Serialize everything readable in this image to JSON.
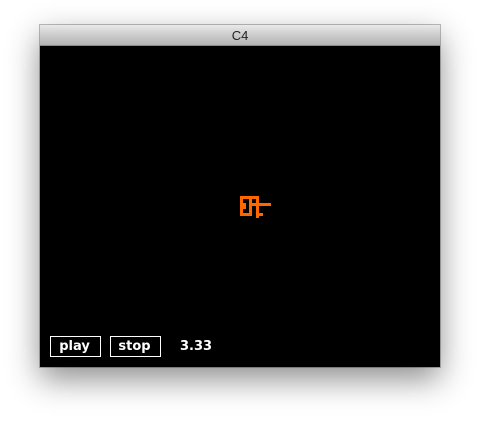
{
  "window": {
    "title": "C4"
  },
  "controls": {
    "play_label": "play",
    "stop_label": "stop",
    "readout": "3.33"
  },
  "colors": {
    "background": "#000000",
    "sprite": "#ff6600",
    "control_text": "#ffffff"
  },
  "sprite": {
    "icon": "pixel-creature-icon"
  }
}
